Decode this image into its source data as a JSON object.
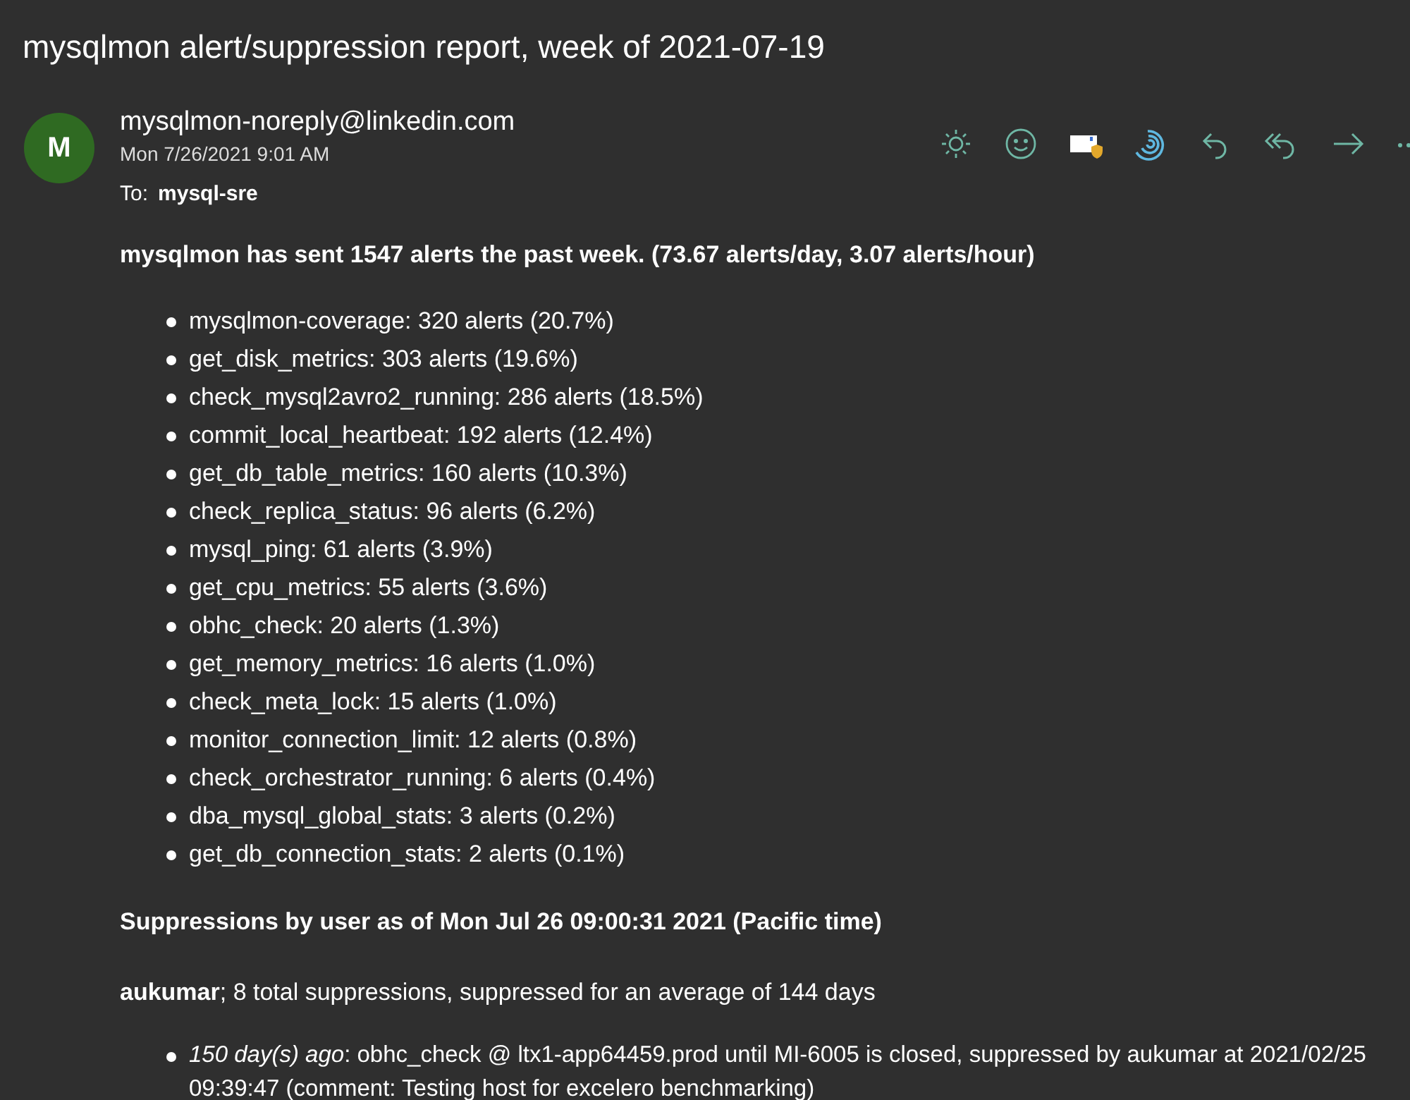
{
  "title": "mysqlmon alert/suppression report, week of 2021-07-19",
  "message": {
    "avatar_initial": "M",
    "sender": "mysqlmon-noreply@linkedin.com",
    "date": "Mon 7/26/2021 9:01 AM",
    "to_label": "To:",
    "to": "mysql-sre"
  },
  "summary": "mysqlmon has sent 1547 alerts the past week. (73.67 alerts/day, 3.07 alerts/hour)",
  "alerts": [
    "mysqlmon-coverage: 320 alerts (20.7%)",
    "get_disk_metrics: 303 alerts (19.6%)",
    "check_mysql2avro2_running: 286 alerts (18.5%)",
    "commit_local_heartbeat: 192 alerts (12.4%)",
    "get_db_table_metrics: 160 alerts (10.3%)",
    "check_replica_status: 96 alerts (6.2%)",
    "mysql_ping: 61 alerts (3.9%)",
    "get_cpu_metrics: 55 alerts (3.6%)",
    "obhc_check: 20 alerts (1.3%)",
    "get_memory_metrics: 16 alerts (1.0%)",
    "check_meta_lock: 15 alerts (1.0%)",
    "monitor_connection_limit: 12 alerts (0.8%)",
    "check_orchestrator_running: 6 alerts (0.4%)",
    "dba_mysql_global_stats: 3 alerts (0.2%)",
    "get_db_connection_stats: 2 alerts (0.1%)"
  ],
  "suppressions_heading": "Suppressions by user as of Mon Jul 26 09:00:31 2021 (Pacific time)",
  "users": [
    {
      "summary": "**aukumar**; 8 total suppressions, suppressed for an average of 144 days",
      "items": [
        "*150 day(s) ago*: obhc_check @ ltx1-app64459.prod until MI-6005 is closed, suppressed by aukumar at 2021/02/25 09:39:47 (comment: Testing host for excelero benchmarking)"
      ]
    }
  ]
}
